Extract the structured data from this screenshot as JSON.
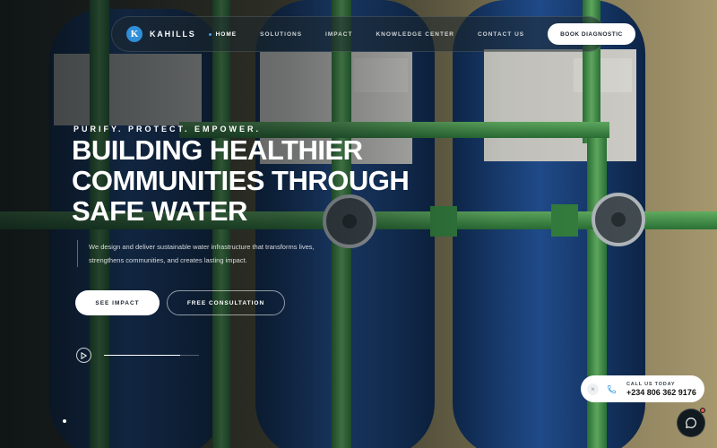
{
  "brand": {
    "logo_letter": "K",
    "name": "KAHILLS"
  },
  "nav": {
    "items": [
      {
        "label": "HOME",
        "active": true
      },
      {
        "label": "SOLUTIONS",
        "active": false
      },
      {
        "label": "IMPACT",
        "active": false
      },
      {
        "label": "KNOWLEDGE CENTER",
        "active": false
      },
      {
        "label": "CONTACT US",
        "active": false
      }
    ],
    "cta_label": "BOOK DIAGNOSTIC"
  },
  "hero": {
    "tagline": "PURIFY. PROTECT. EMPOWER.",
    "headline_lines": [
      "BUILDING HEALTHIER",
      "COMMUNITIES THROUGH",
      "SAFE WATER"
    ],
    "description": "We design and deliver sustainable water infrastructure that transforms lives, strengthens communities, and creates lasting impact.",
    "primary_button": "SEE IMPACT",
    "secondary_button": "FREE CONSULTATION",
    "video_progress": 0.8
  },
  "call_widget": {
    "label": "CALL US TODAY",
    "number": "+234 806 362 9176"
  },
  "icons": {
    "play": "play-icon",
    "phone": "phone-icon",
    "close": "close-icon",
    "chat": "chat-icon"
  },
  "colors": {
    "accent": "#3fa2e6",
    "tank_blue": "#1f4f8e",
    "pipe_green": "#4caf50"
  }
}
